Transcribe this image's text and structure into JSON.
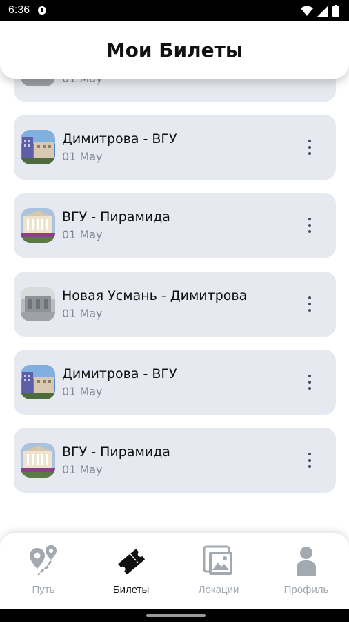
{
  "status_bar": {
    "time": "6:36"
  },
  "header": {
    "title": "Мои Билеты"
  },
  "tickets": [
    {
      "title": "",
      "date": "01 May",
      "thumb": "gray"
    },
    {
      "title": "Димитрова - ВГУ",
      "date": "01 May",
      "thumb": "city"
    },
    {
      "title": "ВГУ - Пирамида",
      "date": "01 May",
      "thumb": "building"
    },
    {
      "title": "Новая Усмань - Димитрова",
      "date": "01 May",
      "thumb": "gray"
    },
    {
      "title": "Димитрова - ВГУ",
      "date": "01 May",
      "thumb": "city"
    },
    {
      "title": "ВГУ - Пирамида",
      "date": "01 May",
      "thumb": "building"
    }
  ],
  "bottom_nav": {
    "items": [
      {
        "label": "Путь",
        "icon": "route-pin-icon",
        "active": false
      },
      {
        "label": "Билеты",
        "icon": "ticket-icon",
        "active": true
      },
      {
        "label": "Локации",
        "icon": "gallery-icon",
        "active": false
      },
      {
        "label": "Профиль",
        "icon": "person-icon",
        "active": false
      }
    ]
  },
  "colors": {
    "card_bg": "#e6eaf0",
    "nav_inactive": "#a3a9b1",
    "nav_active": "#111111"
  }
}
